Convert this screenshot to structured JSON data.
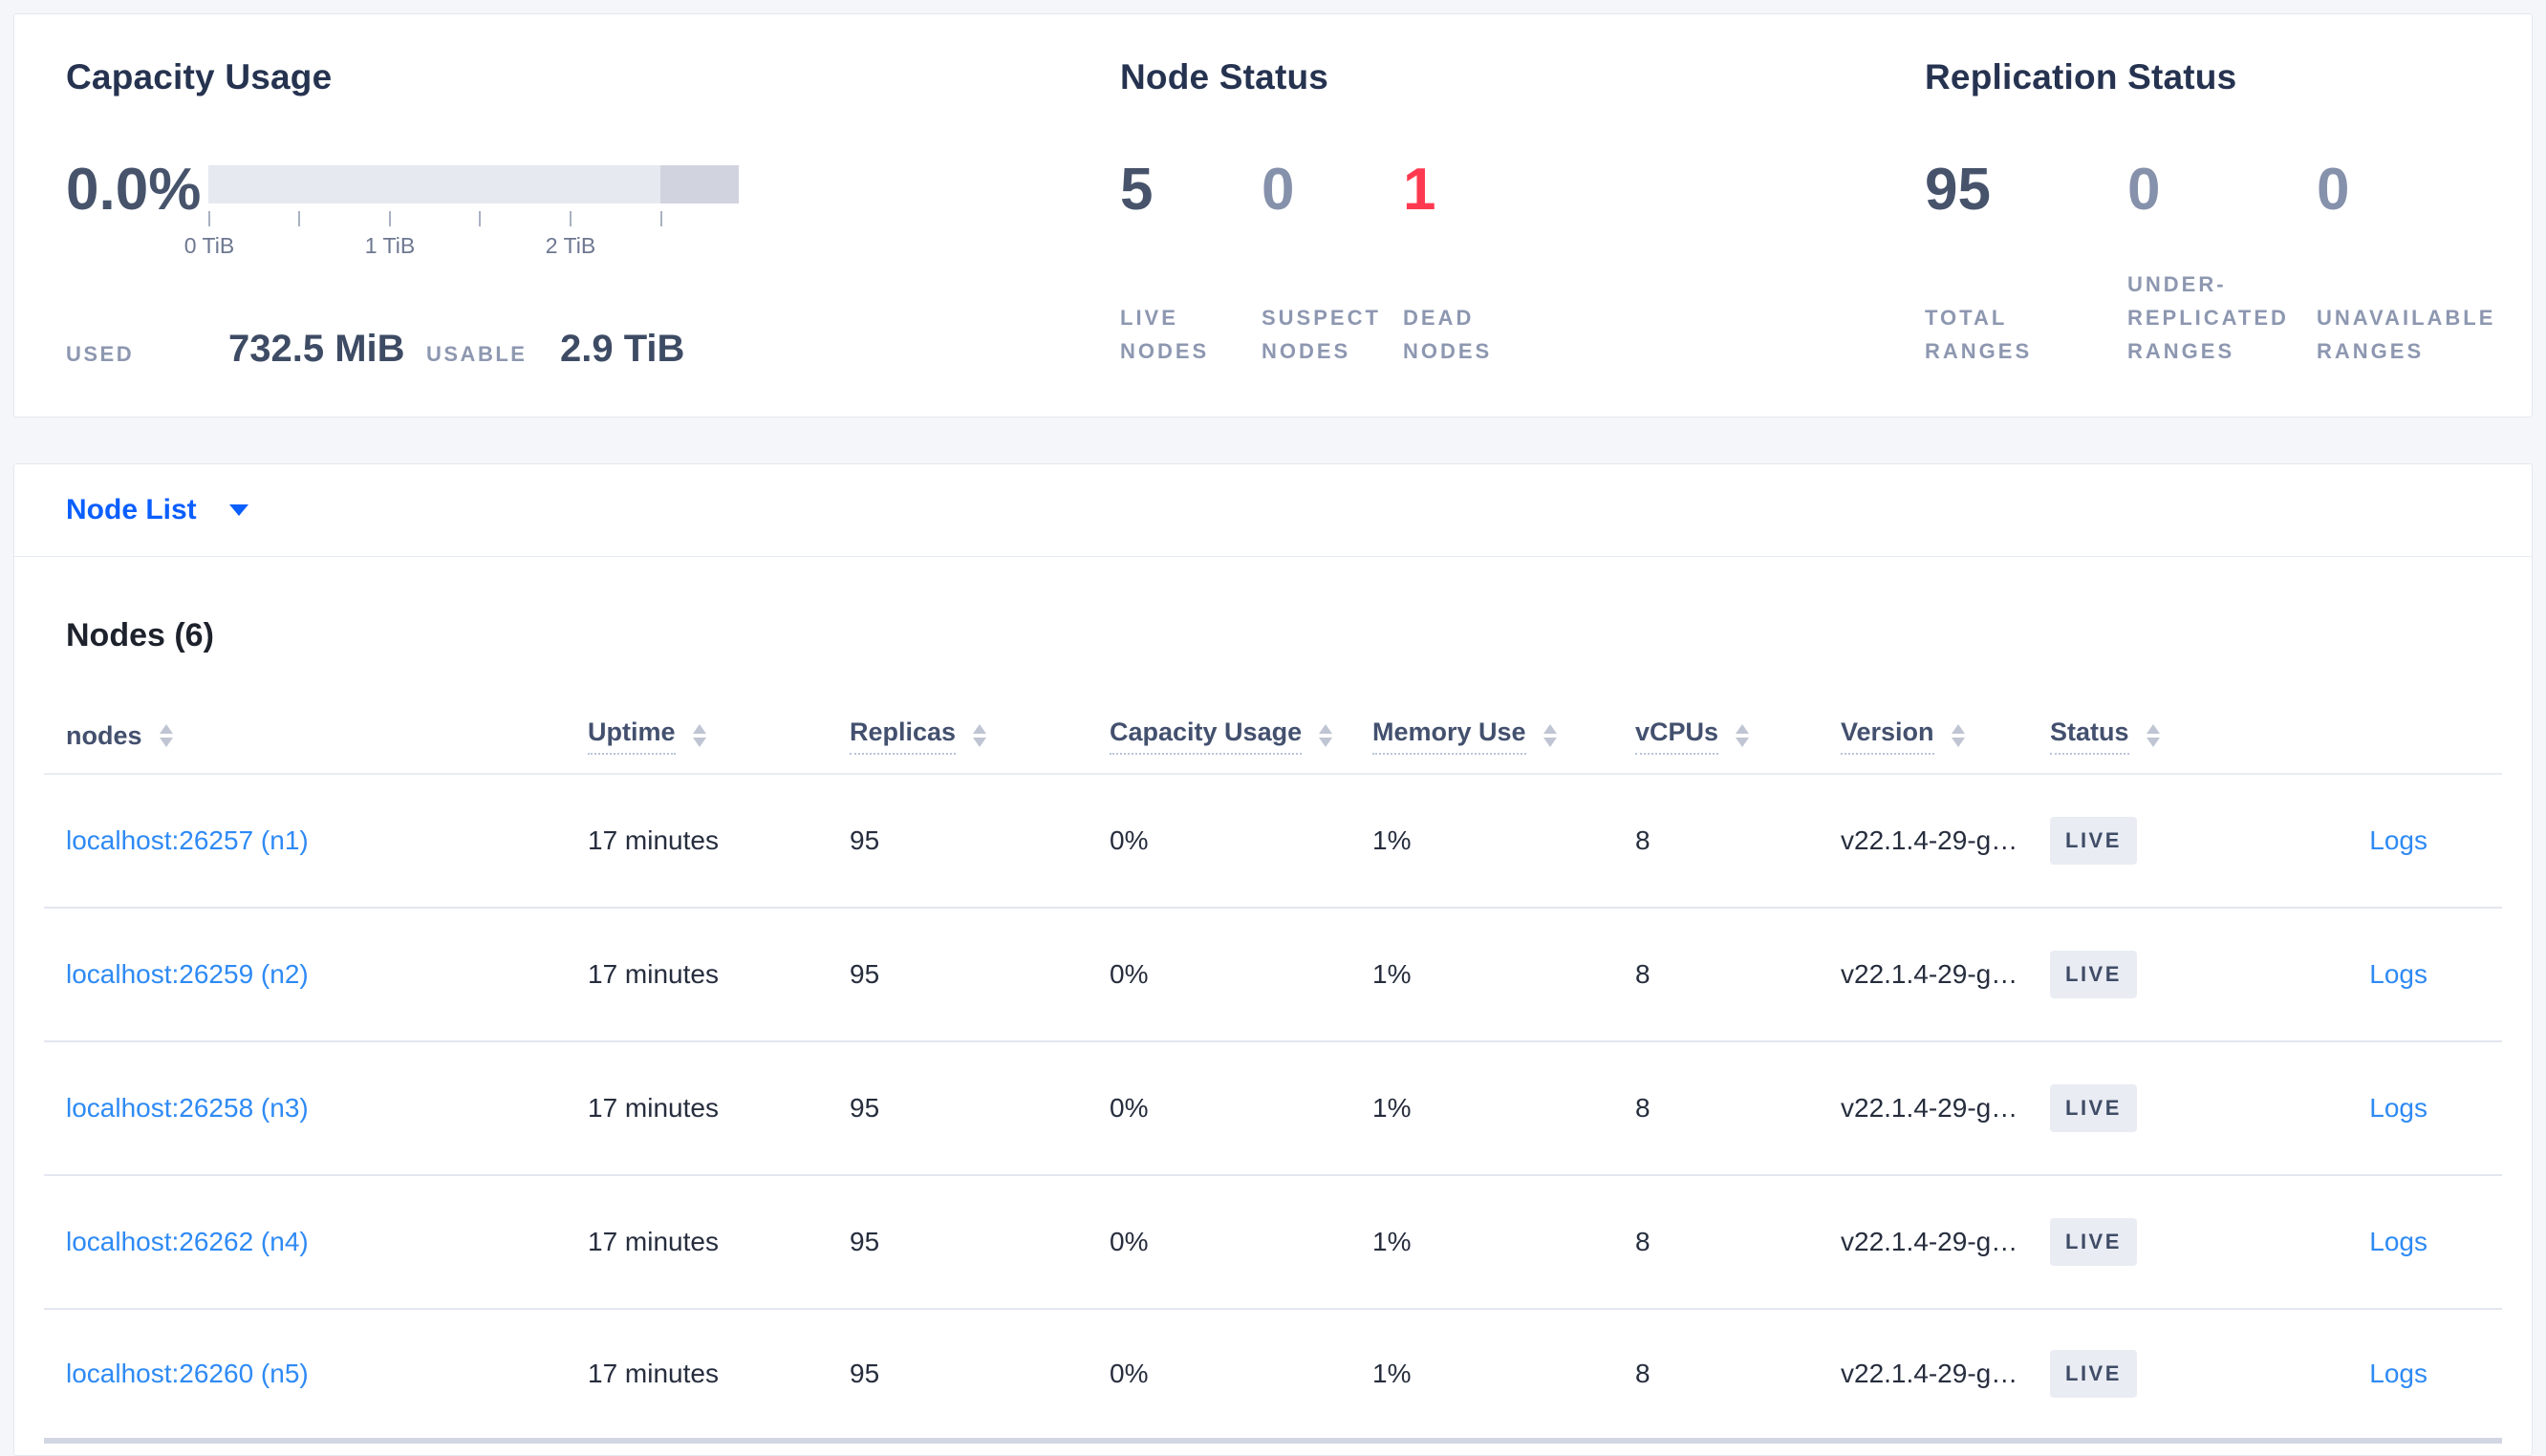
{
  "colors": {
    "accent_blue": "#0b5fff",
    "link_blue": "#2e8af4",
    "dead_red": "#ff3a50",
    "number_dark": "#46536b",
    "number_muted": "#8691ab",
    "label_muted": "#8d97b0",
    "bar_track": "#e7e9f0",
    "bar_dark_segment": "#d1d4df"
  },
  "capacity": {
    "title": "Capacity Usage",
    "percent": "0.0%",
    "tick_labels": [
      "0 TiB",
      "1 TiB",
      "2 TiB"
    ],
    "used_label": "USED",
    "used_value": "732.5 MiB",
    "usable_label": "USABLE",
    "usable_value": "2.9 TiB"
  },
  "node_status": {
    "title": "Node Status",
    "stats": [
      {
        "value": "5",
        "label": "LIVE\nNODES"
      },
      {
        "value": "0",
        "label": "SUSPECT\nNODES"
      },
      {
        "value": "1",
        "label": "DEAD\nNODES"
      }
    ]
  },
  "replication_status": {
    "title": "Replication Status",
    "stats": [
      {
        "value": "95",
        "label": "TOTAL\nRANGES"
      },
      {
        "value": "0",
        "label": "UNDER-\nREPLICATED\nRANGES"
      },
      {
        "value": "0",
        "label": "UNAVAILABLE\nRANGES"
      }
    ]
  },
  "selector": {
    "label": "Node List"
  },
  "nodes": {
    "heading": "Nodes (6)",
    "columns": [
      "nodes",
      "Uptime",
      "Replicas",
      "Capacity Usage",
      "Memory Use",
      "vCPUs",
      "Version",
      "Status"
    ],
    "rows": [
      {
        "node": "localhost:26257 (n1)",
        "uptime": "17 minutes",
        "replicas": "95",
        "capacity_usage": "0%",
        "memory_use": "1%",
        "vcpus": "8",
        "version": "v22.1.4-29-g…",
        "status": "LIVE",
        "logs": "Logs"
      },
      {
        "node": "localhost:26259 (n2)",
        "uptime": "17 minutes",
        "replicas": "95",
        "capacity_usage": "0%",
        "memory_use": "1%",
        "vcpus": "8",
        "version": "v22.1.4-29-g…",
        "status": "LIVE",
        "logs": "Logs"
      },
      {
        "node": "localhost:26258 (n3)",
        "uptime": "17 minutes",
        "replicas": "95",
        "capacity_usage": "0%",
        "memory_use": "1%",
        "vcpus": "8",
        "version": "v22.1.4-29-g…",
        "status": "LIVE",
        "logs": "Logs"
      },
      {
        "node": "localhost:26262 (n4)",
        "uptime": "17 minutes",
        "replicas": "95",
        "capacity_usage": "0%",
        "memory_use": "1%",
        "vcpus": "8",
        "version": "v22.1.4-29-g…",
        "status": "LIVE",
        "logs": "Logs"
      },
      {
        "node": "localhost:26260 (n5)",
        "uptime": "17 minutes",
        "replicas": "95",
        "capacity_usage": "0%",
        "memory_use": "1%",
        "vcpus": "8",
        "version": "v22.1.4-29-g…",
        "status": "LIVE",
        "logs": "Logs"
      }
    ]
  }
}
